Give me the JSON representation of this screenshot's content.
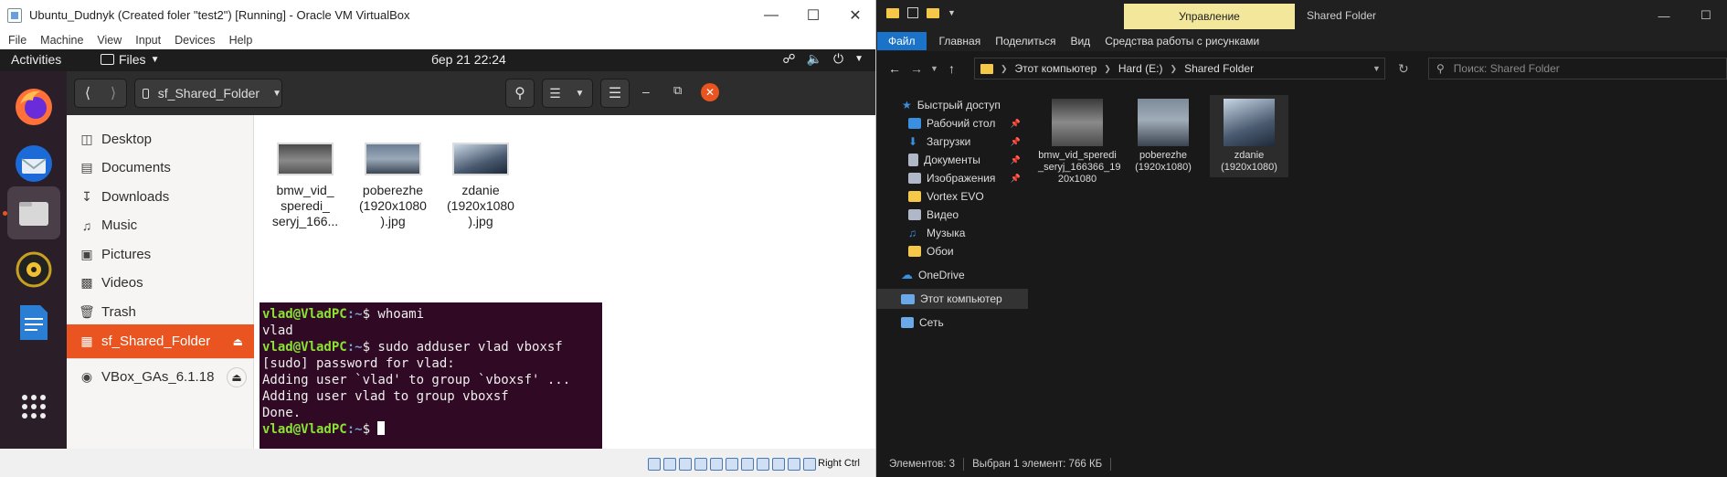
{
  "vbox": {
    "title": "Ubuntu_Dudnyk (Created foler \"test2\") [Running] - Oracle VM VirtualBox",
    "menu": [
      "File",
      "Machine",
      "View",
      "Input",
      "Devices",
      "Help"
    ],
    "status_host_key": "Right Ctrl"
  },
  "ubuntu": {
    "activities": "Activities",
    "files_app": "Files",
    "clock": "бер 21  22:24",
    "path_label": "sf_Shared_Folder",
    "sidebar": [
      {
        "label": "Desktop",
        "icon": "desktop-icon"
      },
      {
        "label": "Documents",
        "icon": "documents-icon"
      },
      {
        "label": "Downloads",
        "icon": "downloads-icon"
      },
      {
        "label": "Music",
        "icon": "music-icon"
      },
      {
        "label": "Pictures",
        "icon": "pictures-icon"
      },
      {
        "label": "Videos",
        "icon": "videos-icon"
      },
      {
        "label": "Trash",
        "icon": "trash-icon"
      },
      {
        "label": "sf_Shared_Folder",
        "icon": "network-folder-icon"
      },
      {
        "label": "VBox_GAs_6.1.18",
        "icon": "disc-icon"
      }
    ],
    "files": [
      {
        "lines": [
          "bmw_vid_",
          "speredi_",
          "seryj_166..."
        ]
      },
      {
        "lines": [
          "poberezhe",
          "(1920x1080",
          ").jpg"
        ]
      },
      {
        "lines": [
          "zdanie",
          "(1920x1080",
          ").jpg"
        ]
      }
    ],
    "terminal": {
      "prompt_user": "vlad@VladPC",
      "prompt_path": ":~",
      "lines": [
        {
          "cmd": "$ whoami"
        },
        {
          "out": "vlad"
        },
        {
          "cmd": "$ sudo adduser vlad vboxsf"
        },
        {
          "out": "[sudo] password for vlad:"
        },
        {
          "out": "Adding user `vlad' to group `vboxsf' ..."
        },
        {
          "out": "Adding user vlad to group vboxsf"
        },
        {
          "out": "Done."
        },
        {
          "cmd": "$ "
        }
      ]
    }
  },
  "explorer": {
    "context_tab": "Управление",
    "window_title": "Shared Folder",
    "ribbon": [
      "Файл",
      "Главная",
      "Поделиться",
      "Вид",
      "Средства работы с рисунками"
    ],
    "breadcrumb": [
      "Этот компьютер",
      "Hard (E:)",
      "Shared Folder"
    ],
    "search_placeholder": "Поиск: Shared Folder",
    "nav": [
      {
        "label": "Быстрый доступ",
        "color": "#3a8fe0",
        "pin": false
      },
      {
        "label": "Рабочий стол",
        "color": "#3a8fe0",
        "pin": true
      },
      {
        "label": "Загрузки",
        "color": "#3a8fe0",
        "pin": true
      },
      {
        "label": "Документы",
        "color": "#b0b8c8",
        "pin": true
      },
      {
        "label": "Изображения",
        "color": "#b0b8c8",
        "pin": true
      },
      {
        "label": "Vortex EVO",
        "color": "#f5c84a",
        "pin": false
      },
      {
        "label": "Видео",
        "color": "#b0b8c8",
        "pin": false
      },
      {
        "label": "Музыка",
        "color": "#3a8fe0",
        "pin": false
      },
      {
        "label": "Обои",
        "color": "#f5c84a",
        "pin": false
      },
      {
        "label": "OneDrive",
        "color": "#3a8fe0",
        "pin": false
      },
      {
        "label": "Этот компьютер",
        "color": "#6aa8e8",
        "pin": false
      },
      {
        "label": "Сеть",
        "color": "#6aa8e8",
        "pin": false
      }
    ],
    "files": [
      {
        "lines": [
          "bmw_vid_speredi",
          "_seryj_166366_19",
          "20x1080"
        ]
      },
      {
        "lines": [
          "poberezhe",
          "(1920x1080)"
        ]
      },
      {
        "lines": [
          "zdanie",
          "(1920x1080)"
        ]
      }
    ],
    "status_count": "Элементов: 3",
    "status_selected": "Выбран 1 элемент: 766 КБ"
  }
}
